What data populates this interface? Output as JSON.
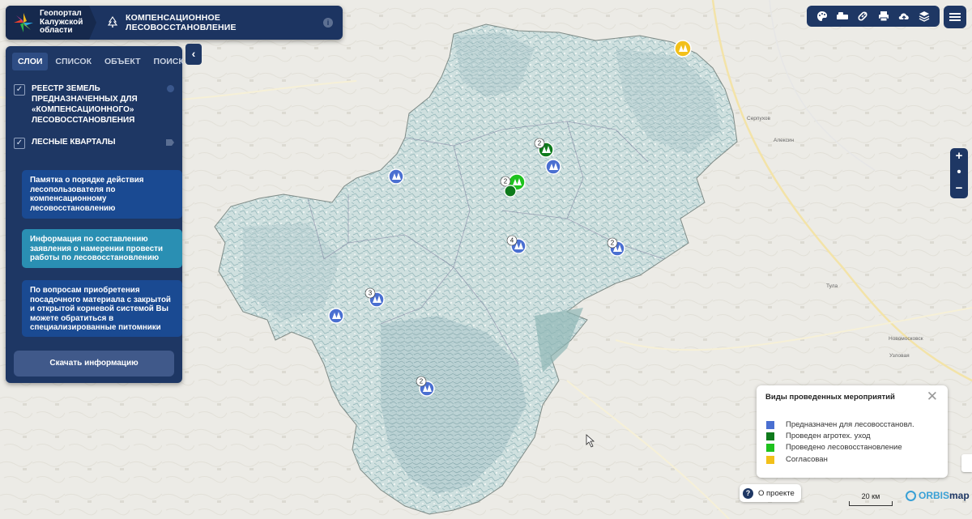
{
  "header": {
    "logo_text": [
      "Геопортал",
      "Калужской",
      "области"
    ],
    "title": "КОМПЕНСАЦИОННОЕ ЛЕСОВОССТАНОВЛЕНИЕ"
  },
  "panel": {
    "tabs": [
      "СЛОИ",
      "СПИСОК",
      "ОБЪЕКТ",
      "ПОИСК"
    ],
    "active_tab": "СЛОИ",
    "layers": [
      {
        "label": "РЕЕСТР ЗЕМЕЛЬ ПРЕДНАЗНАЧЕННЫХ ДЛЯ «КОМПЕНСАЦИОННОГО» ЛЕСОВОССТАНОВЛЕНИЯ",
        "checked": true
      },
      {
        "label": "ЛЕСНЫЕ КВАРТАЛЫ",
        "checked": true
      }
    ],
    "cards": [
      "Памятка о порядке действия лесопользователя по компенсационному лесовосстановлению",
      "Информация по составлению заявления о намерении провести работы по лесовосстановлению",
      "По вопросам приобретения посадочного материала с закрытой и открытой корневой системой Вы можете обратиться в специализированные питомники"
    ],
    "download_label": "Скачать информацию"
  },
  "zoom": {
    "plus": "+",
    "center": "•",
    "minus": "−"
  },
  "legend": {
    "title": "Виды проведенных мероприятий",
    "items": [
      {
        "label": "Предназначен для лесовосстановл.",
        "color": "#4a6fd1"
      },
      {
        "label": "Проведен агротех. уход",
        "color": "#0f7a1c"
      },
      {
        "label": "Проведено лесовосстановление",
        "color": "#1ec21e"
      },
      {
        "label": "Согласован",
        "color": "#f2c01a"
      }
    ]
  },
  "about_label": "О проекте",
  "scale_label": "20 км",
  "brand": {
    "orbis": "ORBIS",
    "map": "map"
  },
  "markers": [
    {
      "status": "Согласован",
      "count": ""
    },
    {
      "status": "Проведен агротех. уход",
      "count": "2"
    },
    {
      "status": "Предназначен для лесовосстановл.",
      "count": ""
    },
    {
      "status": "Проведено лесовосстановление",
      "count": "2"
    },
    {
      "status": "Предназначен для лесовосстановл.",
      "count": ""
    },
    {
      "status": "Предназначен для лесовосстановл.",
      "count": "4"
    },
    {
      "status": "Предназначен для лесовосстановл.",
      "count": "2"
    },
    {
      "status": "Предназначен для лесовосстановл.",
      "count": "3"
    },
    {
      "status": "Предназначен для лесовосстановл.",
      "count": ""
    },
    {
      "status": "Предназначен для лесовосстановл.",
      "count": "2"
    }
  ],
  "place_labels": [
    "Серпухов",
    "Алексин",
    "Новомосковск",
    "Узловая",
    "Тула"
  ]
}
